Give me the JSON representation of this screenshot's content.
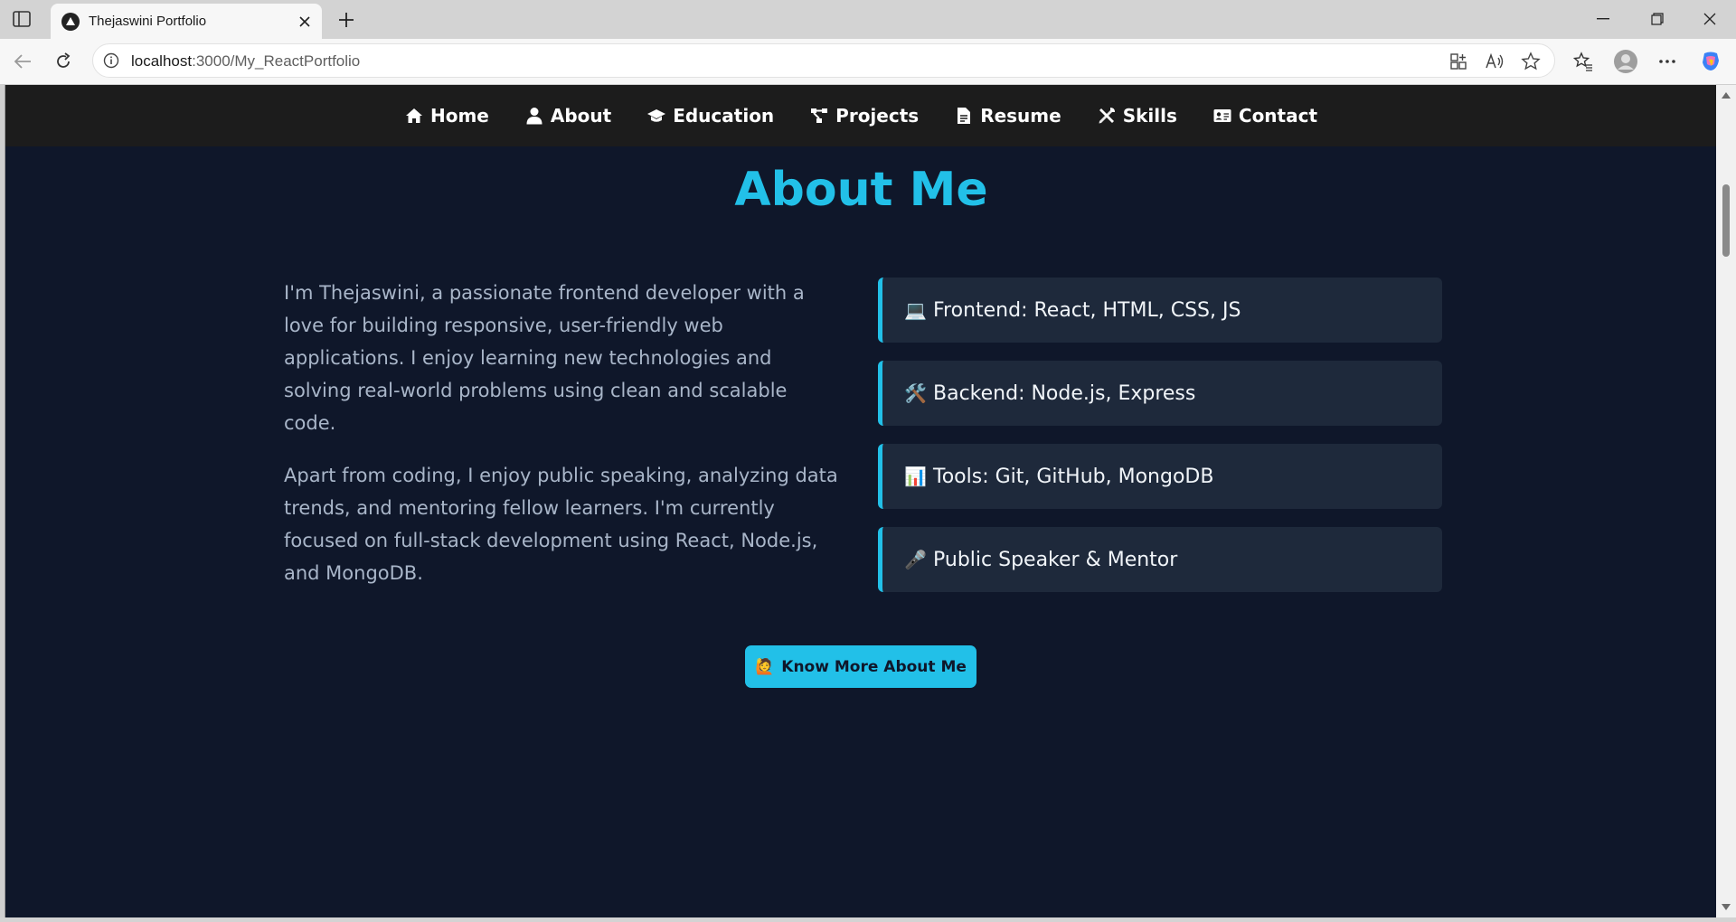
{
  "browser": {
    "tab_title": "Thejaswini Portfolio",
    "url_host": "localhost",
    "url_rest": ":3000/My_ReactPortfolio"
  },
  "nav": {
    "items": [
      {
        "label": "Home",
        "icon": "home-icon"
      },
      {
        "label": "About",
        "icon": "user-icon"
      },
      {
        "label": "Education",
        "icon": "graduation-cap-icon"
      },
      {
        "label": "Projects",
        "icon": "project-diagram-icon"
      },
      {
        "label": "Resume",
        "icon": "file-icon"
      },
      {
        "label": "Skills",
        "icon": "tools-icon"
      },
      {
        "label": "Contact",
        "icon": "address-card-icon"
      }
    ]
  },
  "about": {
    "title": "About Me",
    "paragraphs": [
      "I'm Thejaswini, a passionate frontend developer with a love for building responsive, user-friendly web applications. I enjoy learning new technologies and solving real-world problems using clean and scalable code.",
      "Apart from coding, I enjoy public speaking, analyzing data trends, and mentoring fellow learners. I'm currently focused on full-stack development using React, Node.js, and MongoDB."
    ],
    "cards": [
      {
        "emoji": "💻",
        "text": "Frontend: React, HTML, CSS, JS"
      },
      {
        "emoji": "🛠️",
        "text": "Backend: Node.js, Express"
      },
      {
        "emoji": "📊",
        "text": "Tools: Git, GitHub, MongoDB"
      },
      {
        "emoji": "🎤",
        "text": "Public Speaker & Mentor"
      }
    ],
    "button_emoji": "🙋",
    "button_label": "Know More About Me"
  },
  "colors": {
    "accent": "#22c0e8",
    "page_bg": "#0f172a",
    "card_bg": "#1e293b",
    "navbar_bg": "#1c1c1c"
  }
}
